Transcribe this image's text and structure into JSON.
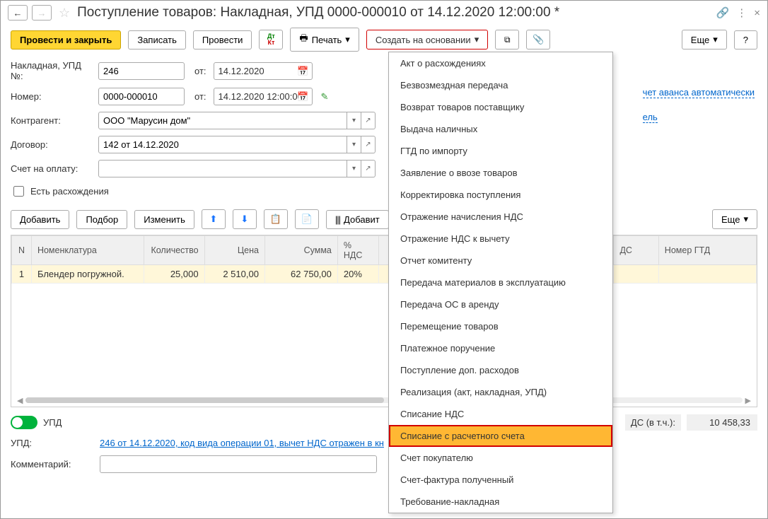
{
  "title": "Поступление товаров: Накладная, УПД 0000-000010 от 14.12.2020 12:00:00 *",
  "toolbar": {
    "post_close": "Провести и закрыть",
    "write": "Записать",
    "post": "Провести",
    "print": "Печать",
    "create_based": "Создать на основании",
    "more": "Еще",
    "help": "?"
  },
  "form": {
    "invoice_lbl": "Накладная, УПД №:",
    "invoice_no": "246",
    "from": "от:",
    "invoice_date": "14.12.2020",
    "number_lbl": "Номер:",
    "number": "0000-000010",
    "number_date": "14.12.2020 12:00:00",
    "counterparty_lbl": "Контрагент:",
    "counterparty": "ООО \"Марусин дом\"",
    "contract_lbl": "Договор:",
    "contract": "142 от 14.12.2020",
    "payacct_lbl": "Счет на оплату:",
    "payacct": "",
    "discrep": "Есть расхождения",
    "right_link1": "чет аванса автоматически",
    "right_link2": "ель"
  },
  "toolbar2": {
    "add": "Добавить",
    "pick": "Подбор",
    "change": "Изменить",
    "addby": "Добавит",
    "more": "Еще"
  },
  "table": {
    "headers": {
      "n": "N",
      "nom": "Номенклатура",
      "qty": "Количество",
      "price": "Цена",
      "sum": "Сумма",
      "vat": "% НДС",
      "vat2": "ДС",
      "gtd": "Номер ГТД"
    },
    "rows": [
      {
        "n": "1",
        "nom": "Блендер погружной.",
        "qty": "25,000",
        "price": "2 510,00",
        "sum": "62 750,00",
        "vat": "20%"
      }
    ]
  },
  "footer": {
    "upd_toggle": "УПД",
    "nds_lbl": "ДС (в т.ч.):",
    "nds_val": "10 458,33",
    "upd_lbl": "УПД:",
    "upd_link": "246 от 14.12.2020, код вида операции 01, вычет НДС отражен в кн",
    "comment_lbl": "Комментарий:",
    "comment": ""
  },
  "dropdown": {
    "items": [
      "Акт о расхождениях",
      "Безвозмездная передача",
      "Возврат товаров поставщику",
      "Выдача наличных",
      "ГТД по импорту",
      "Заявление о ввозе товаров",
      "Корректировка поступления",
      "Отражение начисления НДС",
      "Отражение НДС к вычету",
      "Отчет комитенту",
      "Передача материалов в эксплуатацию",
      "Передача ОС в аренду",
      "Перемещение товаров",
      "Платежное поручение",
      "Поступление доп. расходов",
      "Реализация (акт, накладная, УПД)",
      "Списание НДС",
      "Списание с расчетного счета",
      "Счет покупателю",
      "Счет-фактура полученный",
      "Требование-накладная"
    ],
    "highlighted_index": 17
  }
}
